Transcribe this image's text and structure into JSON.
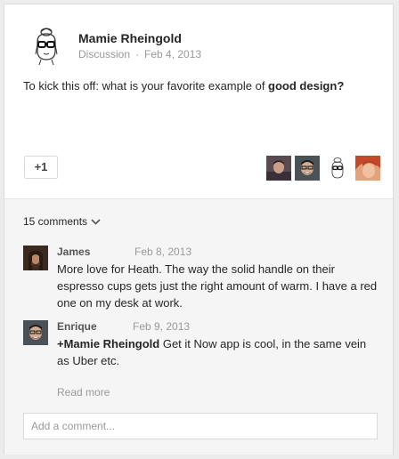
{
  "post": {
    "author": "Mamie Rheingold",
    "category": "Discussion",
    "separator": "·",
    "date": "Feb 4, 2013",
    "text_prefix": "To kick this off: what is your favorite example of ",
    "text_bold": "good design?",
    "plusone_label": "+1",
    "plusers": [
      "man-avatar",
      "glasses-man-avatar",
      "sketch-woman-avatar",
      "redhead-avatar"
    ]
  },
  "comments": {
    "count_label": "15 comments",
    "items": [
      {
        "name": "James",
        "date": "Feb 8, 2013",
        "body": "More love for Heath. The way the solid handle on their espresso cups gets just the right amount of warm. I have a red one on my desk at work."
      },
      {
        "name": "Enrique",
        "date": "Feb 9, 2013",
        "mention": "+Mamie Rheingold",
        "body": " Get it Now app is cool, in the same vein as Uber etc."
      }
    ],
    "read_more": "Read more",
    "add_placeholder": "Add a comment..."
  },
  "colors": {
    "background": "#ececec",
    "card": "#ffffff",
    "comments_bg": "#f5f5f5",
    "text": "#262626",
    "muted": "#999999"
  }
}
